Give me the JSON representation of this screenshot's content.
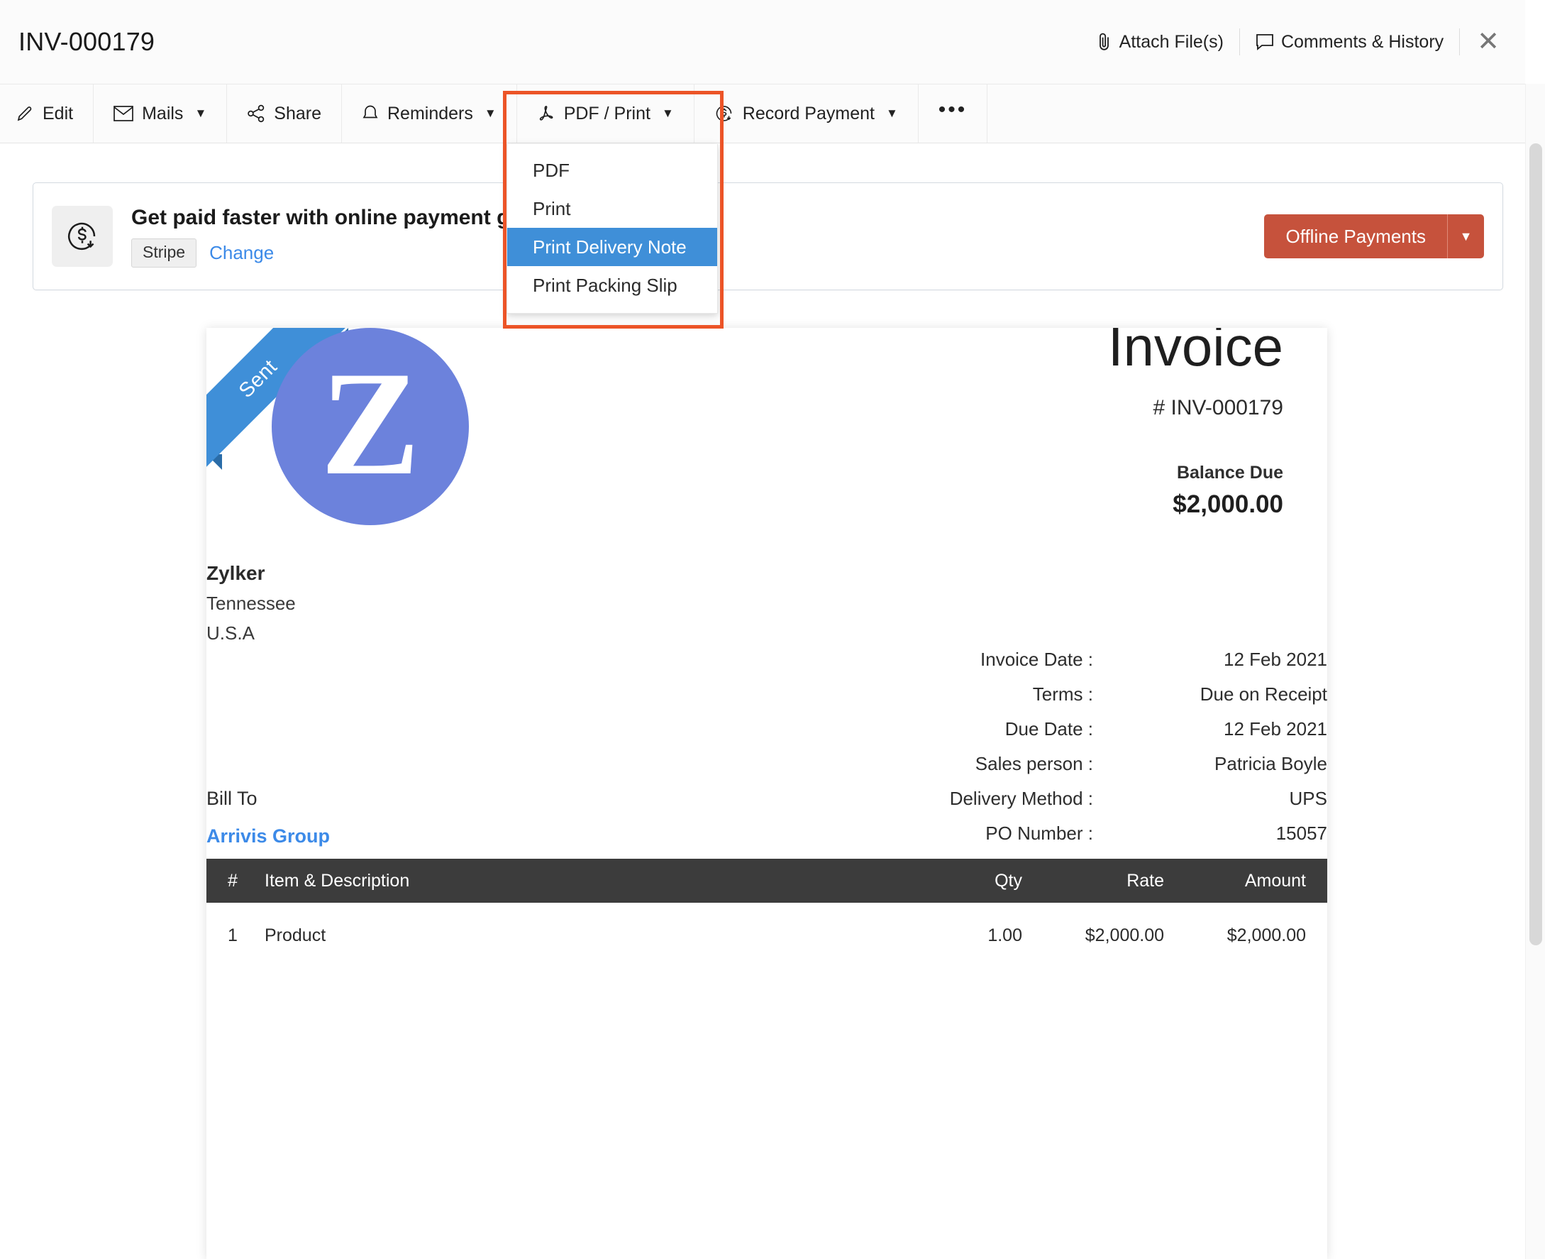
{
  "header": {
    "document_number": "INV-000179",
    "attach_label": "Attach File(s)",
    "comments_label": "Comments & History",
    "close_label": "✕"
  },
  "toolbar": {
    "items": [
      {
        "label": "Edit",
        "icon": "pencil-icon",
        "caret": ""
      },
      {
        "label": "Mails",
        "icon": "envelope-icon",
        "caret": "▼"
      },
      {
        "label": "Share",
        "icon": "share-nodes-icon",
        "caret": ""
      },
      {
        "label": "Reminders",
        "icon": "bell-icon",
        "caret": "▼"
      },
      {
        "label": "PDF / Print",
        "icon": "pdf-icon",
        "caret": "▼"
      },
      {
        "label": "Record Payment",
        "icon": "record-payment-icon",
        "caret": "▼"
      }
    ],
    "more_label": "•••"
  },
  "dropdown": {
    "items": [
      {
        "label": "PDF",
        "active": false
      },
      {
        "label": "Print",
        "active": false
      },
      {
        "label": "Print Delivery Note",
        "active": true
      },
      {
        "label": "Print Packing Slip",
        "active": false
      }
    ],
    "highlight_color": "#3f8fd8",
    "focus_outline_color": "#ec5427"
  },
  "banner": {
    "icon": "money-arrow-down-icon",
    "headline": "Get paid faster with online payment g",
    "gateway_chip": "Stripe",
    "change_link": "Change",
    "primary_button": "Offline Payments",
    "primary_button_caret": "▼",
    "primary_color": "#c6523c"
  },
  "invoice": {
    "status_ribbon": "Sent",
    "ribbon_color": "#3f8fd8",
    "logo_letter": "Z",
    "logo_color": "#6c82dc",
    "title": "Invoice",
    "number_label": "# INV-000179",
    "balance_due_label": "Balance Due",
    "balance_due_amount": "$2,000.00",
    "organization": {
      "name": "Zylker",
      "address_lines": [
        "Tennessee",
        "U.S.A"
      ]
    },
    "meta": [
      {
        "label": "Invoice Date :",
        "value": "12 Feb 2021"
      },
      {
        "label": "Terms :",
        "value": "Due on Receipt"
      },
      {
        "label": "Due Date :",
        "value": "12 Feb 2021"
      },
      {
        "label": "Sales person :",
        "value": "Patricia Boyle"
      },
      {
        "label": "Delivery Method :",
        "value": "UPS"
      },
      {
        "label": "PO Number :",
        "value": "15057"
      }
    ],
    "bill_to_label": "Bill To",
    "bill_to_name": "Arrivis Group",
    "items_table": {
      "columns": [
        "#",
        "Item & Description",
        "Qty",
        "Rate",
        "Amount"
      ],
      "rows": [
        {
          "num": "1",
          "desc": "Product",
          "qty": "1.00",
          "rate": "$2,000.00",
          "amount": "$2,000.00"
        }
      ]
    }
  }
}
